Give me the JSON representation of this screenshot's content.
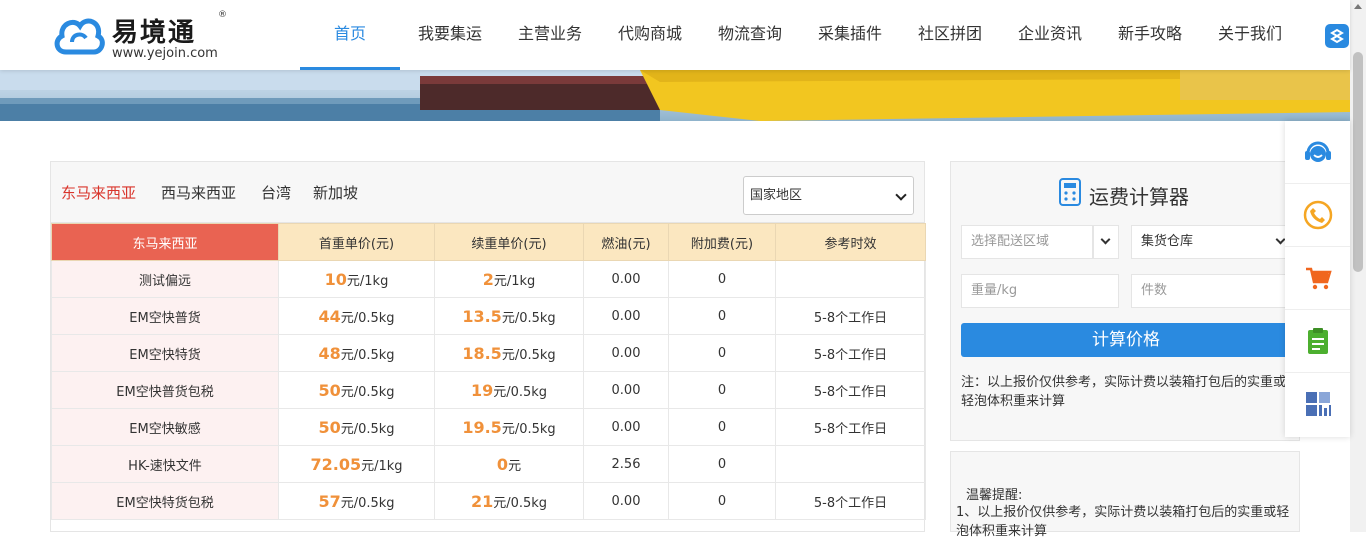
{
  "header": {
    "logo": {
      "brand": "易境通",
      "reg": "®",
      "url": "www.yejoin.com"
    },
    "nav": [
      {
        "label": "首页",
        "active": true
      },
      {
        "label": "我要集运"
      },
      {
        "label": "主营业务"
      },
      {
        "label": "代购商城"
      },
      {
        "label": "物流查询"
      },
      {
        "label": "采集插件"
      },
      {
        "label": "社区拼团"
      },
      {
        "label": "企业资讯"
      },
      {
        "label": "新手攻略"
      },
      {
        "label": "关于我们"
      }
    ]
  },
  "price_panel": {
    "tabs": [
      {
        "label": "东马来西亚",
        "active": true
      },
      {
        "label": "西马来西亚"
      },
      {
        "label": "台湾"
      },
      {
        "label": "新加坡"
      }
    ],
    "country_select": {
      "value": "国家地区"
    },
    "table": {
      "headers": [
        "东马来西亚",
        "首重单价(元)",
        "续重单价(元)",
        "燃油(元)",
        "附加费(元)",
        "参考时效"
      ],
      "rows": [
        {
          "name": "测试偏远",
          "first": "10",
          "first_unit": "元/1kg",
          "cont": "2",
          "cont_unit": "元/1kg",
          "fuel": "0.00",
          "extra": "0",
          "time": ""
        },
        {
          "name": "EM空快普货",
          "first": "44",
          "first_unit": "元/0.5kg",
          "cont": "13.5",
          "cont_unit": "元/0.5kg",
          "fuel": "0.00",
          "extra": "0",
          "time": "5-8个工作日"
        },
        {
          "name": "EM空快特货",
          "first": "48",
          "first_unit": "元/0.5kg",
          "cont": "18.5",
          "cont_unit": "元/0.5kg",
          "fuel": "0.00",
          "extra": "0",
          "time": "5-8个工作日"
        },
        {
          "name": "EM空快普货包税",
          "first": "50",
          "first_unit": "元/0.5kg",
          "cont": "19",
          "cont_unit": "元/0.5kg",
          "fuel": "0.00",
          "extra": "0",
          "time": "5-8个工作日"
        },
        {
          "name": "EM空快敏感",
          "first": "50",
          "first_unit": "元/0.5kg",
          "cont": "19.5",
          "cont_unit": "元/0.5kg",
          "fuel": "0.00",
          "extra": "0",
          "time": "5-8个工作日"
        },
        {
          "name": "HK-速快文件",
          "first": "72.05",
          "first_unit": "元/1kg",
          "cont": "0",
          "cont_unit": "元",
          "fuel": "2.56",
          "extra": "0",
          "time": ""
        },
        {
          "name": "EM空快特货包税",
          "first": "57",
          "first_unit": "元/0.5kg",
          "cont": "21",
          "cont_unit": "元/0.5kg",
          "fuel": "0.00",
          "extra": "0",
          "time": "5-8个工作日"
        }
      ]
    }
  },
  "calculator": {
    "title": "运费计算器",
    "region_placeholder": "选择配送区域",
    "warehouse_value": "集货仓库",
    "weight_placeholder": "重量/kg",
    "count_placeholder": "件数",
    "button_label": "计算价格",
    "note": "注：以上报价仅供参考，实际计费以装箱打包后的实重或轻泡体积重来计算"
  },
  "tips": {
    "title": "温馨提醒:",
    "text": "1、以上报价仅供参考，实际计费以装箱打包后的实重或轻泡体积重来计算"
  },
  "colors": {
    "accent": "#2a8ae0",
    "price": "#f0913a",
    "tab_active": "#d9342b",
    "header_first": "#e96352"
  },
  "side_tools": [
    {
      "icon": "customer-service-icon",
      "color": "#2a8ae0"
    },
    {
      "icon": "phone-icon",
      "color": "#f5a623"
    },
    {
      "icon": "cart-icon",
      "color": "#f0661e"
    },
    {
      "icon": "clipboard-icon",
      "color": "#4caf2f"
    },
    {
      "icon": "qrcode-icon",
      "color": "#4a6fb5"
    }
  ]
}
